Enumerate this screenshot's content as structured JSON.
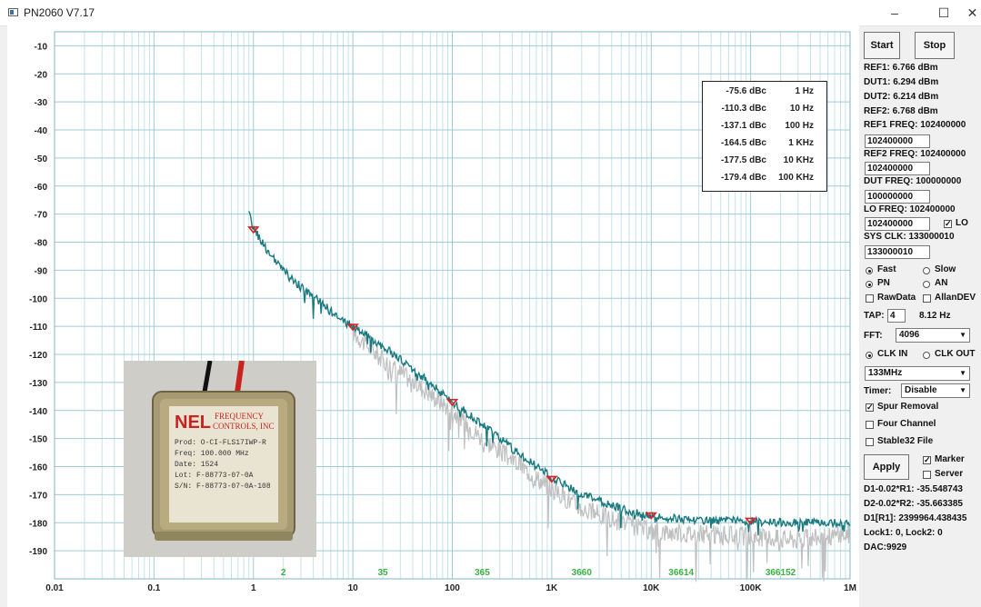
{
  "window": {
    "title": "PN2060 V7.17",
    "minimize": "–",
    "maximize": "☐",
    "close": "✕"
  },
  "chart_data": {
    "type": "line",
    "x_scale": "log",
    "x_range": [
      0.01,
      1000000
    ],
    "y_range": [
      -200,
      -5
    ],
    "y_ticks": [
      -10,
      -20,
      -30,
      -40,
      -50,
      -60,
      -70,
      -80,
      -90,
      -100,
      -110,
      -120,
      -130,
      -140,
      -150,
      -160,
      -170,
      -180,
      -190
    ],
    "x_ticks": [
      {
        "v": 0.01,
        "label": "0.01"
      },
      {
        "v": 0.1,
        "label": "0.1"
      },
      {
        "v": 1,
        "label": "1"
      },
      {
        "v": 10,
        "label": "10"
      },
      {
        "v": 100,
        "label": "100"
      },
      {
        "v": 1000,
        "label": "1K"
      },
      {
        "v": 10000,
        "label": "10K"
      },
      {
        "v": 100000,
        "label": "100K"
      },
      {
        "v": 1000000,
        "label": "1M"
      }
    ],
    "averaging_labels": [
      {
        "v": 2,
        "label": "2"
      },
      {
        "v": 20,
        "label": "35"
      },
      {
        "v": 200,
        "label": "365"
      },
      {
        "v": 2000,
        "label": "3660"
      },
      {
        "v": 20000,
        "label": "36614"
      },
      {
        "v": 200000,
        "label": "366152"
      }
    ],
    "series": [
      {
        "color": "#1a7a80",
        "x": [
          0.9,
          1,
          1.5,
          2,
          3,
          5,
          7,
          10,
          20,
          50,
          100,
          200,
          500,
          1000,
          2000,
          5000,
          10000,
          30000,
          100000,
          300000,
          1000000
        ],
        "y": [
          -70,
          -75,
          -85,
          -90,
          -96,
          -102,
          -107,
          -110,
          -117,
          -128,
          -137,
          -145,
          -156,
          -164,
          -170,
          -175,
          -178,
          -179,
          -179.5,
          -180,
          -180
        ]
      },
      {
        "color": "#c0c0c0",
        "x": [
          10,
          20,
          50,
          100,
          200,
          500,
          1000,
          2000,
          5000,
          10000,
          30000,
          100000,
          300000,
          1000000
        ],
        "y": [
          -112,
          -122,
          -132,
          -140,
          -150,
          -160,
          -168,
          -175,
          -180,
          -183,
          -184,
          -185,
          -186,
          -184
        ]
      }
    ],
    "markers": [
      {
        "x": 1,
        "y": -75.6
      },
      {
        "x": 10,
        "y": -110.3
      },
      {
        "x": 100,
        "y": -137.1
      },
      {
        "x": 1000,
        "y": -164.5
      },
      {
        "x": 10000,
        "y": -177.5
      },
      {
        "x": 100000,
        "y": -179.4
      }
    ],
    "legend": [
      {
        "value": "-75.6 dBc",
        "freq": "1 Hz"
      },
      {
        "value": "-110.3 dBc",
        "freq": "10 Hz"
      },
      {
        "value": "-137.1 dBc",
        "freq": "100 Hz"
      },
      {
        "value": "-164.5 dBc",
        "freq": "1 KHz"
      },
      {
        "value": "-177.5 dBc",
        "freq": "10 KHz"
      },
      {
        "value": "-179.4 dBc",
        "freq": "100 KHz"
      }
    ],
    "legend_placement": "top-right",
    "grid": true
  },
  "photo": {
    "brand": "NEL",
    "company_line1": "FREQUENCY",
    "company_line2": "CONTROLS, INC",
    "prod": "Prod: O-CI-FLS17IWP-R",
    "freq": "Freq: 100.000 MHz",
    "date": "Date: 1524",
    "lot": "Lot: F-88773-07-0A",
    "sn": "S/N: F-88773-07-0A-108"
  },
  "panel": {
    "start_label": "Start",
    "stop_label": "Stop",
    "ref1": "REF1: 6.766 dBm",
    "dut1": "DUT1: 6.294 dBm",
    "dut2": "DUT2: 6.214 dBm",
    "ref2": "REF2: 6.768 dBm",
    "ref1_freq_label": "REF1 FREQ: 102400000",
    "ref1_freq_value": "102400000",
    "ref2_freq_label": "REF2 FREQ: 102400000",
    "ref2_freq_value": "102400000",
    "dut_freq_label": "DUT  FREQ: 100000000",
    "dut_freq_value": "100000000",
    "lo_freq_label": "LO FREQ: 102400000",
    "lo_freq_value": "102400000",
    "lo_check_label": "LO",
    "sys_clk_label": "SYS CLK: 133000010",
    "sys_clk_value": "133000010",
    "fast_label": "Fast",
    "slow_label": "Slow",
    "pn_label": "PN",
    "an_label": "AN",
    "rawdata_label": "RawData",
    "allandev_label": "AllanDEV",
    "tap_label": "TAP:",
    "tap_value": "4",
    "tap_freq": "8.12 Hz",
    "fft_label": "FFT:",
    "fft_value": "4096",
    "clk_in_label": "CLK IN",
    "clk_out_label": "CLK OUT",
    "clk_select_value": "133MHz",
    "timer_label": "Timer:",
    "timer_value": "Disable",
    "spur_label": "Spur Removal",
    "four_channel_label": "Four Channel",
    "stable32_label": "Stable32 File",
    "apply_label": "Apply",
    "marker_label": "Marker",
    "server_label": "Server",
    "d1": "D1-0.02*R1: -35.548743",
    "d2": "D2-0.02*R2: -35.663385",
    "d1r1": "D1[R1]: 2399964.438435",
    "lock": "Lock1: 0, Lock2: 0",
    "dac": "DAC:9929"
  }
}
